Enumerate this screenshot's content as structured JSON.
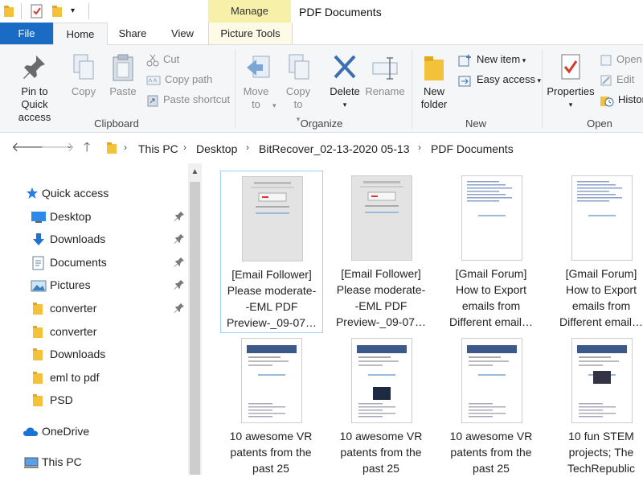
{
  "window": {
    "title": "PDF Documents",
    "context_tab_group": "Manage"
  },
  "ribbon_tabs": [
    {
      "label": "File"
    },
    {
      "label": "Home"
    },
    {
      "label": "Share"
    },
    {
      "label": "View"
    },
    {
      "label": "Picture Tools"
    }
  ],
  "ribbon": {
    "clipboard": {
      "label": "Clipboard",
      "pin": "Pin to Quick access",
      "copy": "Copy",
      "paste": "Paste",
      "cut": "Cut",
      "copy_path": "Copy path",
      "paste_shortcut": "Paste shortcut"
    },
    "organize": {
      "label": "Organize",
      "move_to": "Move to",
      "copy_to": "Copy to",
      "delete": "Delete",
      "rename": "Rename"
    },
    "new": {
      "label": "New",
      "new_folder": "New folder",
      "new_item": "New item",
      "easy_access": "Easy access"
    },
    "open": {
      "label": "Open",
      "properties": "Properties",
      "open": "Open",
      "edit": "Edit",
      "history": "Histor"
    }
  },
  "address": {
    "crumbs": [
      "This PC",
      "Desktop",
      "BitRecover_02-13-2020 05-13",
      "PDF Documents"
    ]
  },
  "nav_pane": {
    "quick_access": "Quick access",
    "items": [
      {
        "label": "Desktop",
        "icon": "desktop-icon",
        "pinned": true
      },
      {
        "label": "Downloads",
        "icon": "downloads-icon",
        "pinned": true
      },
      {
        "label": "Documents",
        "icon": "documents-icon",
        "pinned": true
      },
      {
        "label": "Pictures",
        "icon": "pictures-icon",
        "pinned": true
      },
      {
        "label": "converter",
        "icon": "folder-icon",
        "pinned": true
      },
      {
        "label": "converter",
        "icon": "folder-icon",
        "pinned": false
      },
      {
        "label": "Downloads",
        "icon": "folder-icon",
        "pinned": false
      },
      {
        "label": "eml to pdf",
        "icon": "folder-icon",
        "pinned": false
      },
      {
        "label": "PSD",
        "icon": "folder-icon",
        "pinned": false
      }
    ],
    "onedrive": "OneDrive",
    "this_pc": "This PC"
  },
  "files": [
    {
      "line1": "[Email Follower]",
      "line2": "Please moderate-",
      "line3": "-EML PDF",
      "line4": "Preview-_09-07…"
    },
    {
      "line1": "[Email Follower]",
      "line2": "Please moderate-",
      "line3": "-EML PDF",
      "line4": "Preview-_09-07…"
    },
    {
      "line1": "[Gmail Forum]",
      "line2": "How to Export",
      "line3": "emails from",
      "line4": "Different email…"
    },
    {
      "line1": "[Gmail Forum]",
      "line2": "How to Export",
      "line3": "emails from",
      "line4": "Different email…"
    },
    {
      "line1": "10 awesome VR",
      "line2": "patents from the",
      "line3": "past 25",
      "line4": ""
    },
    {
      "line1": "10 awesome VR",
      "line2": "patents from the",
      "line3": "past 25",
      "line4": ""
    },
    {
      "line1": "10 awesome VR",
      "line2": "patents from the",
      "line3": "past 25",
      "line4": ""
    },
    {
      "line1": "10 fun STEM",
      "line2": "projects; The",
      "line3": "TechRepublic",
      "line4": ""
    }
  ],
  "colors": {
    "file_tab": "#1a6bc4",
    "manage_tab": "#f7f0a8",
    "selection": "#99d1ff",
    "folder": "#f3c13a"
  }
}
